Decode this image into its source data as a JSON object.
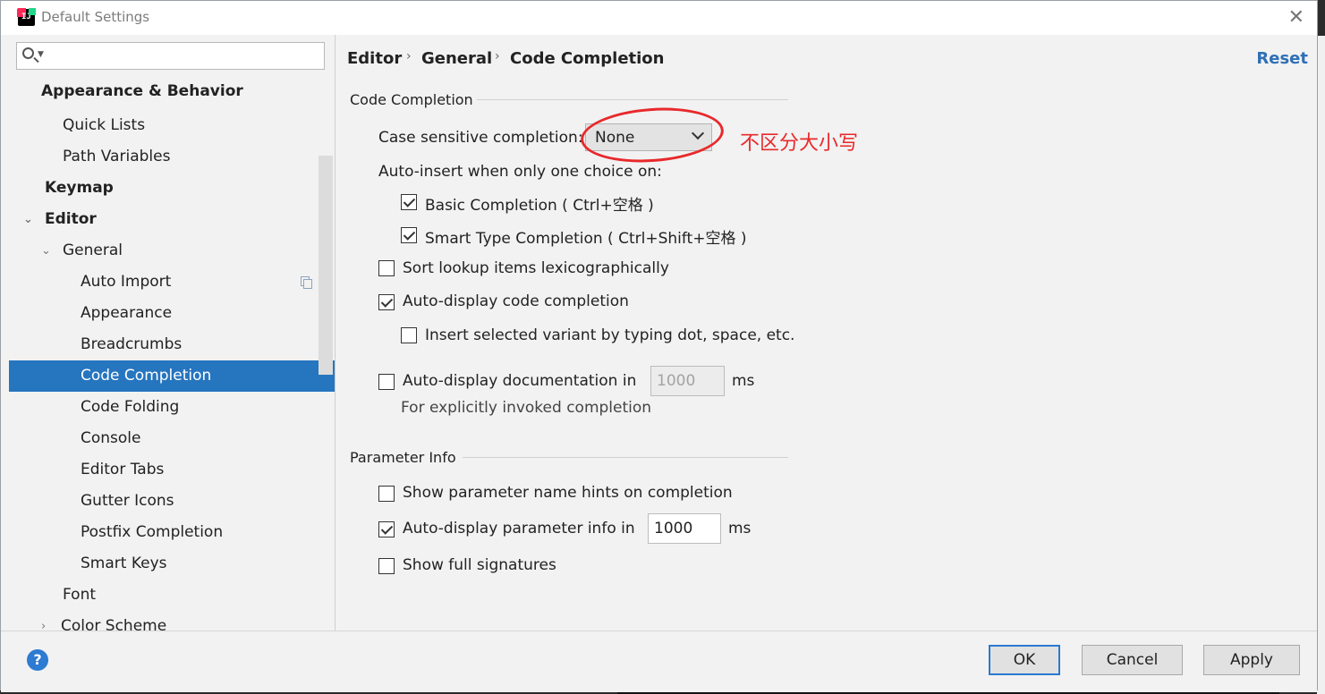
{
  "window": {
    "title": "Default Settings"
  },
  "search": {
    "placeholder": ""
  },
  "sidebar": {
    "items": [
      {
        "label": "Appearance & Behavior"
      },
      {
        "label": "Quick Lists"
      },
      {
        "label": "Path Variables"
      },
      {
        "label": "Keymap"
      },
      {
        "label": "Editor"
      },
      {
        "label": "General"
      },
      {
        "label": "Auto Import"
      },
      {
        "label": "Appearance"
      },
      {
        "label": "Breadcrumbs"
      },
      {
        "label": "Code Completion"
      },
      {
        "label": "Code Folding"
      },
      {
        "label": "Console"
      },
      {
        "label": "Editor Tabs"
      },
      {
        "label": "Gutter Icons"
      },
      {
        "label": "Postfix Completion"
      },
      {
        "label": "Smart Keys"
      },
      {
        "label": "Font"
      },
      {
        "label": "Color Scheme"
      }
    ],
    "selected": "Code Completion"
  },
  "breadcrumb": {
    "items": [
      "Editor",
      "General",
      "Code Completion"
    ],
    "separator": "›",
    "reset_label": "Reset"
  },
  "code_completion": {
    "group_title": "Code Completion",
    "case_sensitive_label": "Case sensitive completion:",
    "case_sensitive_value": "None",
    "auto_insert_label": "Auto-insert when only one choice on:",
    "basic_completion": {
      "label": "Basic Completion ( Ctrl+空格 )",
      "checked": true
    },
    "smart_type_completion": {
      "label": "Smart Type Completion ( Ctrl+Shift+空格 )",
      "checked": true
    },
    "sort_lexico": {
      "label": "Sort lookup items lexicographically",
      "checked": false
    },
    "auto_display_completion": {
      "label": "Auto-display code completion",
      "checked": true
    },
    "insert_by_typing": {
      "label": "Insert selected variant by typing dot, space, etc.",
      "checked": false
    },
    "auto_display_doc": {
      "label": "Auto-display documentation in",
      "checked": false,
      "value": "1000",
      "unit": "ms"
    },
    "explicit_note": "For explicitly invoked completion"
  },
  "parameter_info": {
    "group_title": "Parameter Info",
    "name_hints": {
      "label": "Show parameter name hints on completion",
      "checked": false
    },
    "auto_display_param": {
      "label": "Auto-display parameter info in",
      "checked": true,
      "value": "1000",
      "unit": "ms"
    },
    "full_signatures": {
      "label": "Show full signatures",
      "checked": false
    }
  },
  "annotation": {
    "text": "不区分大小写",
    "color": "#e8292b"
  },
  "footer": {
    "help_label": "?",
    "ok_label": "OK",
    "cancel_label": "Cancel",
    "apply_label": "Apply"
  },
  "colors": {
    "selection": "#2675bf",
    "link": "#2f6fb6",
    "help": "#2d7bd2"
  }
}
